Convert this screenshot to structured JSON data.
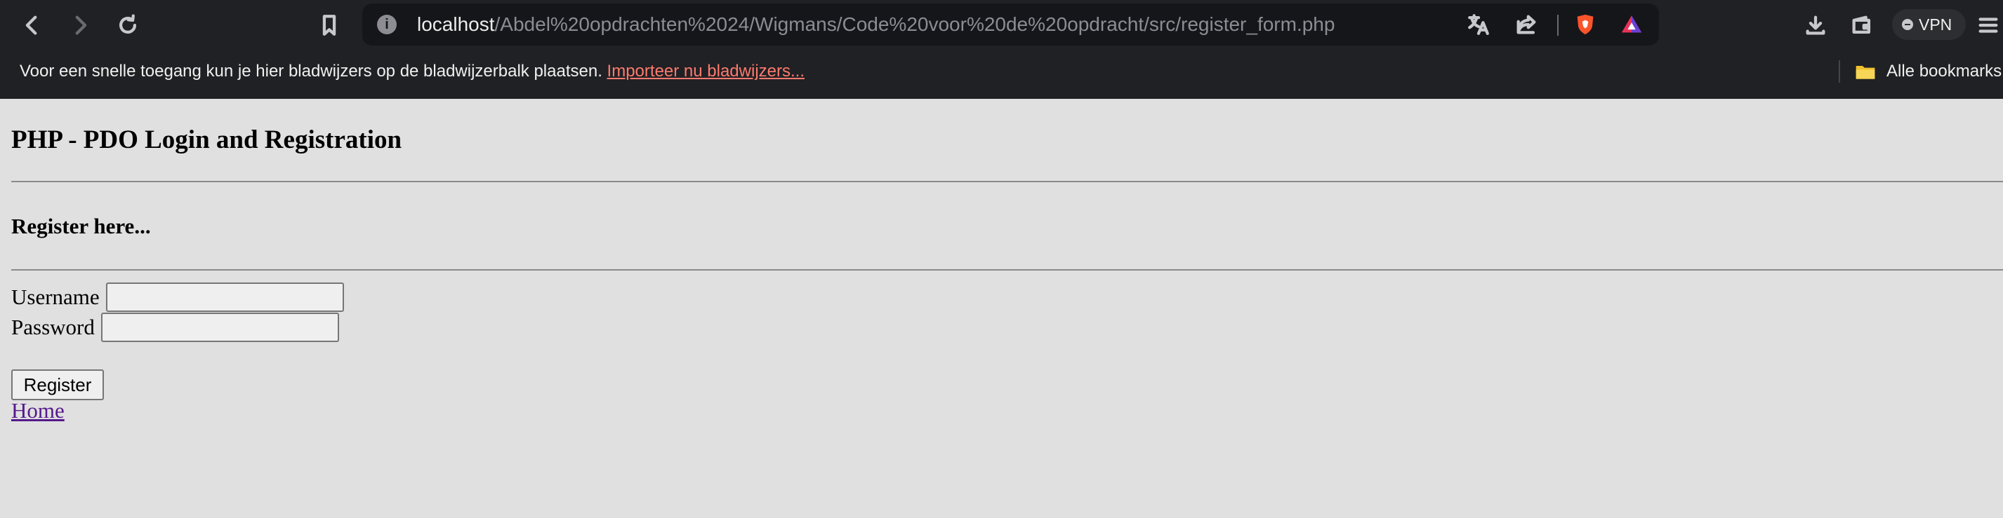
{
  "browser": {
    "url_host": "localhost",
    "url_path": "/Abdel%20opdrachten%2024/Wigmans/Code%20voor%20de%20opdracht/src/register_form.php",
    "vpn_label": "VPN",
    "bookmarks_bar": {
      "message": "Voor een snelle toegang kun je hier bladwijzers op de bladwijzerbalk plaatsen.",
      "import_link": "Importeer nu bladwijzers...",
      "all_bookmarks": "Alle bookmarks"
    },
    "icons": [
      "back-icon",
      "forward-icon",
      "reload-icon",
      "bookmark-icon",
      "info-icon",
      "translate-icon",
      "share-icon",
      "brave-shields-icon",
      "brave-rewards-icon",
      "download-icon",
      "wallet-icon",
      "menu-icon",
      "folder-icon"
    ]
  },
  "page": {
    "title": "PHP - PDO Login and Registration",
    "subtitle": "Register here...",
    "username_label": "Username",
    "password_label": "Password",
    "register_button": "Register",
    "home_link": "Home"
  },
  "colors": {
    "page_bg": "#e0e0e0",
    "chrome_bg": "#202124",
    "link_visited": "#551a8b",
    "import_link": "#ff7a6e"
  }
}
